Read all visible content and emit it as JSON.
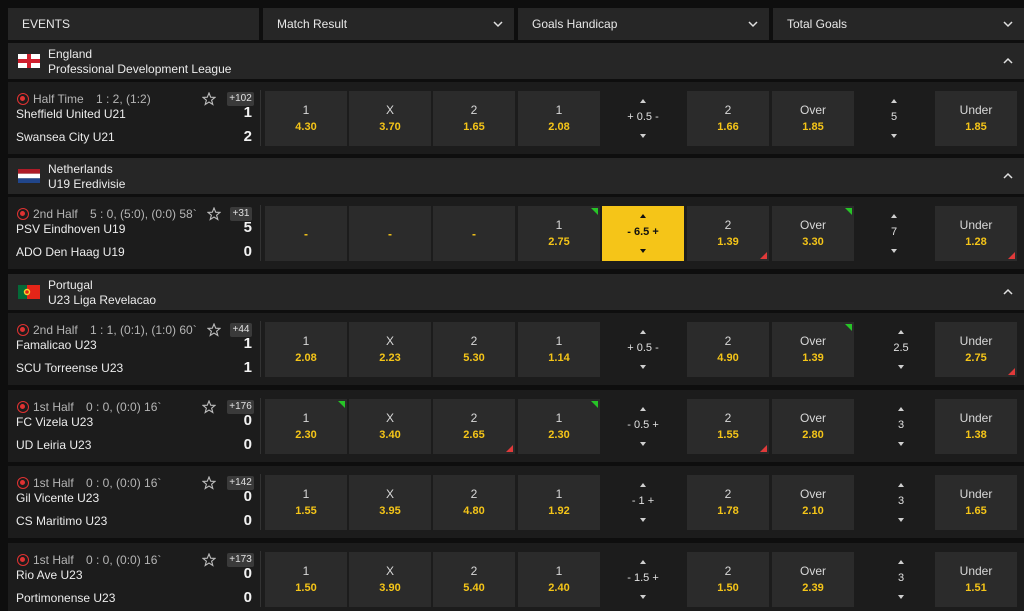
{
  "header": {
    "events_label": "EVENTS",
    "match_result_label": "Match Result",
    "goals_handicap_label": "Goals Handicap",
    "total_goals_label": "Total Goals"
  },
  "leagues": [
    {
      "country": "England",
      "name": "Professional Development League"
    },
    {
      "country": "Netherlands",
      "name": "U19 Eredivisie"
    },
    {
      "country": "Portugal",
      "name": "U23 Liga Revelacao"
    }
  ],
  "events": [
    {
      "period": "Half Time",
      "info": "1 : 2, (1:2)",
      "home": "Sheffield United U21",
      "away": "Swansea City U21",
      "home_score": "1",
      "away_score": "2",
      "more": "+102",
      "mr": [
        {
          "label": "1",
          "odd": "4.30"
        },
        {
          "label": "X",
          "odd": "3.70"
        },
        {
          "label": "2",
          "odd": "1.65"
        }
      ],
      "gh": {
        "home": {
          "label": "1",
          "odd": "2.08"
        },
        "line": "+ 0.5 -",
        "away": {
          "label": "2",
          "odd": "1.66"
        }
      },
      "tg": {
        "over": {
          "label": "Over",
          "odd": "1.85"
        },
        "line": "5",
        "under": {
          "label": "Under",
          "odd": "1.85"
        }
      }
    },
    {
      "period": "2nd Half",
      "info": "5 : 0, (5:0), (0:0) 58`",
      "home": "PSV Eindhoven U19",
      "away": "ADO Den Haag U19",
      "home_score": "5",
      "away_score": "0",
      "more": "+31",
      "mr": [
        {
          "label": "",
          "odd": "-"
        },
        {
          "label": "",
          "odd": "-"
        },
        {
          "label": "",
          "odd": "-"
        }
      ],
      "gh": {
        "home": {
          "label": "1",
          "odd": "2.75"
        },
        "line": "- 6.5 +",
        "away": {
          "label": "2",
          "odd": "1.39"
        }
      },
      "tg": {
        "over": {
          "label": "Over",
          "odd": "3.30"
        },
        "line": "7",
        "under": {
          "label": "Under",
          "odd": "1.28"
        }
      }
    },
    {
      "period": "2nd Half",
      "info": "1 : 1, (0:1), (1:0) 60`",
      "home": "Famalicao U23",
      "away": "SCU Torreense U23",
      "home_score": "1",
      "away_score": "1",
      "more": "+44",
      "mr": [
        {
          "label": "1",
          "odd": "2.08"
        },
        {
          "label": "X",
          "odd": "2.23"
        },
        {
          "label": "2",
          "odd": "5.30"
        }
      ],
      "gh": {
        "home": {
          "label": "1",
          "odd": "1.14"
        },
        "line": "+ 0.5 -",
        "away": {
          "label": "2",
          "odd": "4.90"
        }
      },
      "tg": {
        "over": {
          "label": "Over",
          "odd": "1.39"
        },
        "line": "2.5",
        "under": {
          "label": "Under",
          "odd": "2.75"
        }
      }
    },
    {
      "period": "1st Half",
      "info": "0 : 0, (0:0) 16`",
      "home": "FC Vizela U23",
      "away": "UD Leiria U23",
      "home_score": "0",
      "away_score": "0",
      "more": "+176",
      "mr": [
        {
          "label": "1",
          "odd": "2.30"
        },
        {
          "label": "X",
          "odd": "3.40"
        },
        {
          "label": "2",
          "odd": "2.65"
        }
      ],
      "gh": {
        "home": {
          "label": "1",
          "odd": "2.30"
        },
        "line": "- 0.5 +",
        "away": {
          "label": "2",
          "odd": "1.55"
        }
      },
      "tg": {
        "over": {
          "label": "Over",
          "odd": "2.80"
        },
        "line": "3",
        "under": {
          "label": "Under",
          "odd": "1.38"
        }
      }
    },
    {
      "period": "1st Half",
      "info": "0 : 0, (0:0) 16`",
      "home": "Gil Vicente U23",
      "away": "CS Maritimo U23",
      "home_score": "0",
      "away_score": "0",
      "more": "+142",
      "mr": [
        {
          "label": "1",
          "odd": "1.55"
        },
        {
          "label": "X",
          "odd": "3.95"
        },
        {
          "label": "2",
          "odd": "4.80"
        }
      ],
      "gh": {
        "home": {
          "label": "1",
          "odd": "1.92"
        },
        "line": "- 1 +",
        "away": {
          "label": "2",
          "odd": "1.78"
        }
      },
      "tg": {
        "over": {
          "label": "Over",
          "odd": "2.10"
        },
        "line": "3",
        "under": {
          "label": "Under",
          "odd": "1.65"
        }
      }
    },
    {
      "period": "1st Half",
      "info": "0 : 0, (0:0) 16`",
      "home": "Rio Ave U23",
      "away": "Portimonense U23",
      "home_score": "0",
      "away_score": "0",
      "more": "+173",
      "mr": [
        {
          "label": "1",
          "odd": "1.50"
        },
        {
          "label": "X",
          "odd": "3.90"
        },
        {
          "label": "2",
          "odd": "5.40"
        }
      ],
      "gh": {
        "home": {
          "label": "1",
          "odd": "2.40"
        },
        "line": "- 1.5 +",
        "away": {
          "label": "2",
          "odd": "1.50"
        }
      },
      "tg": {
        "over": {
          "label": "Over",
          "odd": "2.39"
        },
        "line": "3",
        "under": {
          "label": "Under",
          "odd": "1.51"
        }
      }
    }
  ],
  "colors": {
    "accent": "#f5c518",
    "live": "#e03232",
    "up": "#27c427",
    "down": "#e03a3a",
    "row_bg": "#1c1c1c",
    "cell_bg": "#2b2b2b"
  }
}
